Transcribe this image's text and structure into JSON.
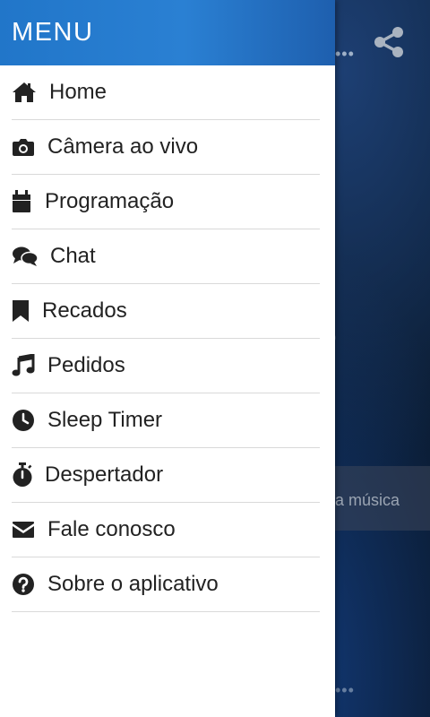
{
  "drawer": {
    "title": "MENU",
    "items": [
      {
        "label": "Home",
        "icon": "home-icon"
      },
      {
        "label": "Câmera ao vivo",
        "icon": "camera-icon"
      },
      {
        "label": "Programação",
        "icon": "calendar-icon"
      },
      {
        "label": "Chat",
        "icon": "chat-bubbles-icon"
      },
      {
        "label": "Recados",
        "icon": "bookmark-icon"
      },
      {
        "label": "Pedidos",
        "icon": "music-note-icon"
      },
      {
        "label": "Sleep Timer",
        "icon": "clock-icon"
      },
      {
        "label": "Despertador",
        "icon": "stopwatch-icon"
      },
      {
        "label": "Fale conosco",
        "icon": "envelope-icon"
      },
      {
        "label": "Sobre o aplicativo",
        "icon": "question-circle-icon"
      }
    ]
  },
  "background": {
    "banner_text": "a música"
  },
  "colors": {
    "header": "#2176c9",
    "text": "#222222",
    "divider": "#d9d9d9"
  }
}
